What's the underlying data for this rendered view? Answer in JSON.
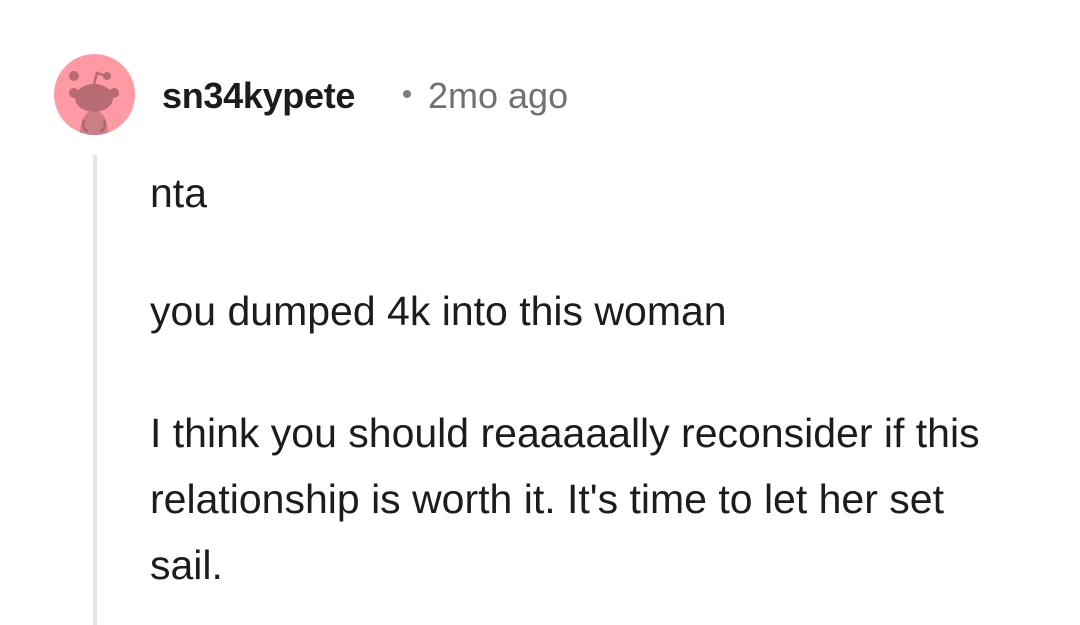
{
  "comment": {
    "author": {
      "username": "sn34kypete",
      "avatar_icon": "snoo-avatar-icon",
      "avatar_bg": "#ff9aa5"
    },
    "meta": {
      "separator": "•",
      "timestamp": "2mo ago"
    },
    "body": {
      "paragraphs": [
        "nta",
        "you dumped 4k into this woman",
        "I think you should reaaaaally reconsider if this relationship is worth it. It's time to let her set sail."
      ]
    }
  },
  "colors": {
    "text": "#1c1c1c",
    "muted": "#6f7173",
    "thread_line": "#e5e5e5"
  }
}
